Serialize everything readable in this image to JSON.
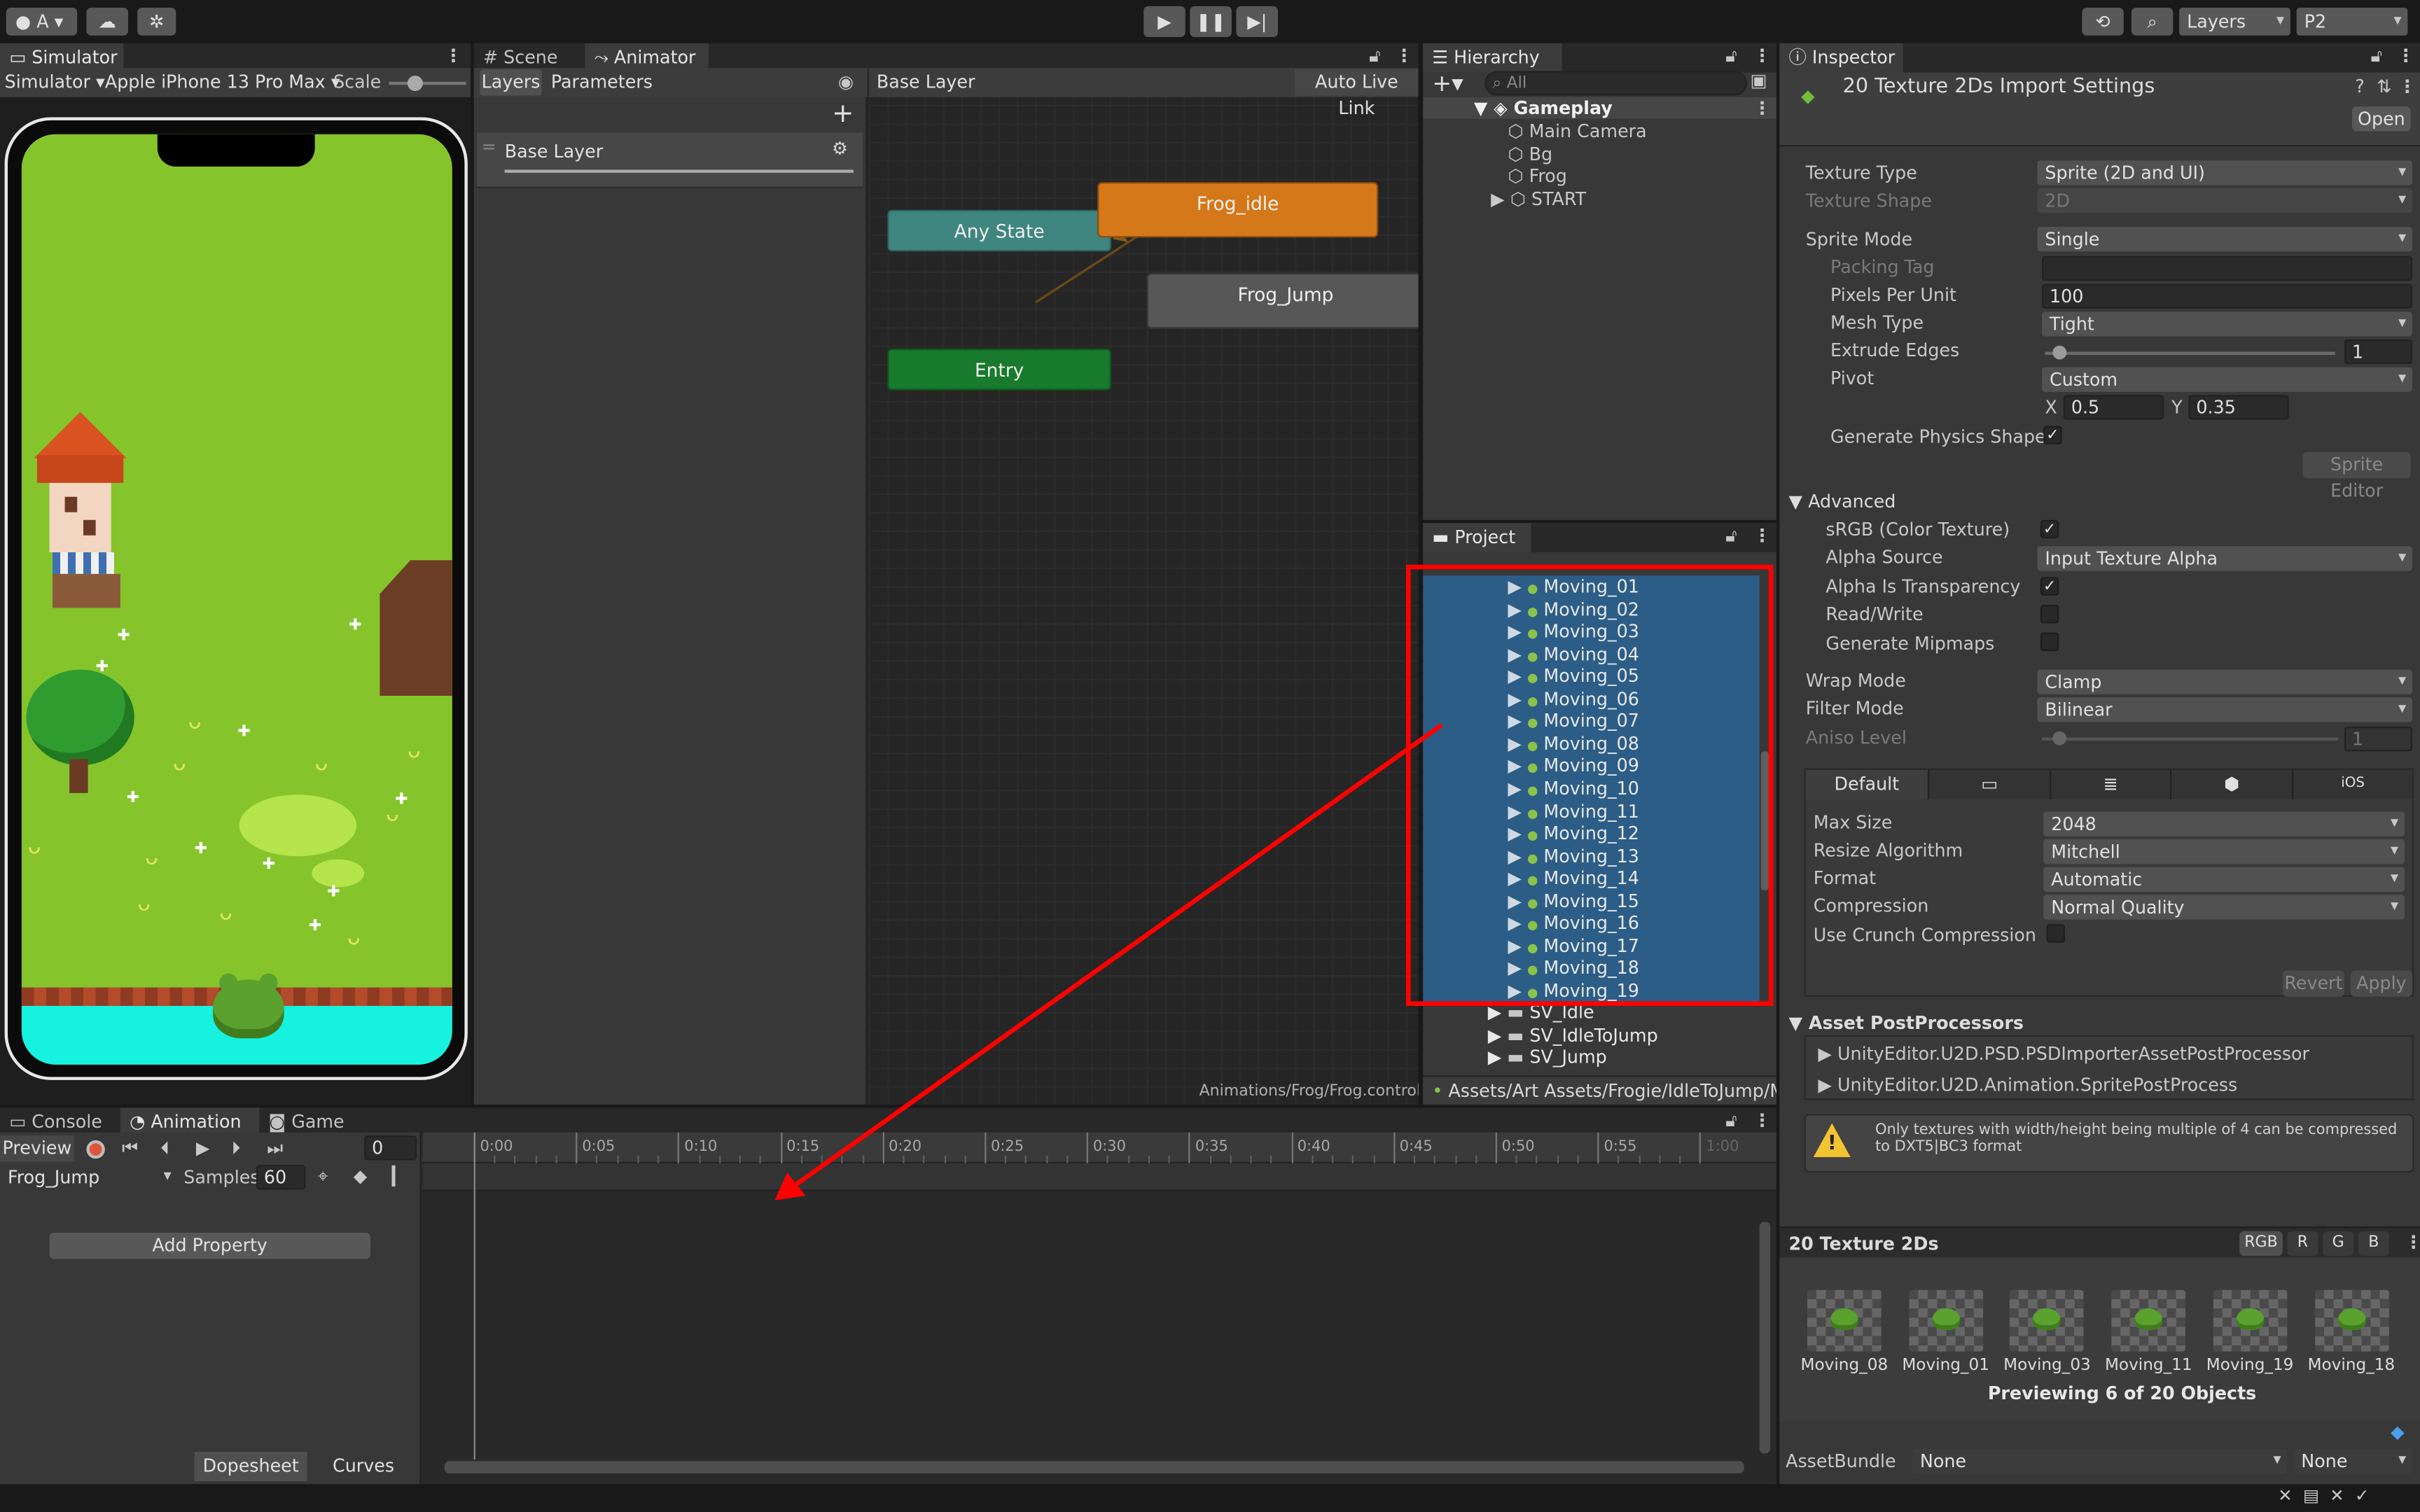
{
  "colors": {
    "accent": "#ff0000",
    "selection": "#2c5d87",
    "orange_state": "#d9791a",
    "teal_state": "#3a8a85",
    "green_state": "#18802f",
    "gray_state": "#5c5c5c"
  },
  "toolbar": {
    "account": "A",
    "layers": "Layers",
    "layout": "P2"
  },
  "simulator": {
    "tab": "Simulator",
    "mode": "Simulator",
    "device": "Apple iPhone 13 Pro Max",
    "scale_label": "Scale"
  },
  "scene_tab": "Scene",
  "animator": {
    "tab": "Animator",
    "tabs": [
      "Layers",
      "Parameters"
    ],
    "breadcrumb": "Base Layer",
    "live_link": "Auto Live Link",
    "layer_name": "Base Layer",
    "states": {
      "any": "Any State",
      "idle": "Frog_idle",
      "jump": "Frog_Jump",
      "entry": "Entry"
    },
    "footer_path": "Animations/Frog/Frog.controller"
  },
  "hierarchy": {
    "tab": "Hierarchy",
    "search_placeholder": "All",
    "scene": "Gameplay",
    "items": [
      "Main Camera",
      "Bg",
      "Frog",
      "START"
    ]
  },
  "project": {
    "tab": "Project",
    "files": [
      "Moving_01",
      "Moving_02",
      "Moving_03",
      "Moving_04",
      "Moving_05",
      "Moving_06",
      "Moving_07",
      "Moving_08",
      "Moving_09",
      "Moving_10",
      "Moving_11",
      "Moving_12",
      "Moving_13",
      "Moving_14",
      "Moving_15",
      "Moving_16",
      "Moving_17",
      "Moving_18",
      "Moving_19"
    ],
    "folders": [
      "SV_Idle",
      "SV_IdleToJump",
      "SV_Jump"
    ],
    "path": "Assets/Art Assets/Frogie/IdleToJump/Mo"
  },
  "inspector": {
    "tab": "Inspector",
    "title": "20 Texture 2Ds Import Settings",
    "open_btn": "Open",
    "props": {
      "texture_type": {
        "label": "Texture Type",
        "value": "Sprite (2D and UI)"
      },
      "texture_shape": {
        "label": "Texture Shape",
        "value": "2D"
      },
      "sprite_mode": {
        "label": "Sprite Mode",
        "value": "Single"
      },
      "packing_tag": {
        "label": "Packing Tag",
        "value": ""
      },
      "ppu": {
        "label": "Pixels Per Unit",
        "value": "100"
      },
      "mesh_type": {
        "label": "Mesh Type",
        "value": "Tight"
      },
      "extrude": {
        "label": "Extrude Edges",
        "value": "1",
        "fraction": 0.05
      },
      "pivot": {
        "label": "Pivot",
        "value": "Custom"
      },
      "pivot_x": {
        "label": "X",
        "value": "0.5"
      },
      "pivot_y": {
        "label": "Y",
        "value": "0.35"
      },
      "physics": {
        "label": "Generate Physics Shape"
      },
      "sprite_editor": "Sprite Editor",
      "advanced": "Advanced",
      "srgb": {
        "label": "sRGB (Color Texture)"
      },
      "alpha_source": {
        "label": "Alpha Source",
        "value": "Input Texture Alpha"
      },
      "alpha_transp": {
        "label": "Alpha Is Transparency"
      },
      "read_write": {
        "label": "Read/Write"
      },
      "mipmaps": {
        "label": "Generate Mipmaps"
      },
      "wrap": {
        "label": "Wrap Mode",
        "value": "Clamp"
      },
      "filter": {
        "label": "Filter Mode",
        "value": "Bilinear"
      },
      "aniso": {
        "label": "Aniso Level",
        "value": "1",
        "fraction": 0.05
      }
    },
    "platform": {
      "default_tab": "Default",
      "ios_tab": "iOS",
      "max_size": {
        "label": "Max Size",
        "value": "2048"
      },
      "resize": {
        "label": "Resize Algorithm",
        "value": "Mitchell"
      },
      "format": {
        "label": "Format",
        "value": "Automatic"
      },
      "compression": {
        "label": "Compression",
        "value": "Normal Quality"
      },
      "crunch": {
        "label": "Use Crunch Compression"
      }
    },
    "revert": "Revert",
    "apply": "Apply",
    "postprocessors": {
      "title": "Asset PostProcessors",
      "items": [
        "UnityEditor.U2D.PSD.PSDImporterAssetPostProcessor",
        "UnityEditor.U2D.Animation.SpritePostProcess"
      ]
    },
    "warning": "Only textures with width/height being multiple of 4 can be compressed to DXT5|BC3 format",
    "preview": {
      "title": "20 Texture 2Ds",
      "channels": [
        "RGB",
        "R",
        "G",
        "B"
      ],
      "thumbs": [
        "Moving_08",
        "Moving_01",
        "Moving_03",
        "Moving_11",
        "Moving_19",
        "Moving_18"
      ],
      "caption": "Previewing 6 of 20 Objects"
    },
    "assetbundle": {
      "label": "AssetBundle",
      "name": "None",
      "variant": "None"
    }
  },
  "bottom": {
    "tabs": [
      "Console",
      "Animation",
      "Game"
    ],
    "preview_label": "Preview",
    "frame": "0",
    "clip": "Frog_Jump",
    "samples_label": "Samples",
    "samples": "60",
    "add_property": "Add Property",
    "ticks": [
      "0:00",
      "0:05",
      "0:10",
      "0:15",
      "0:20",
      "0:25",
      "0:30",
      "0:35",
      "0:40",
      "0:45",
      "0:50",
      "0:55",
      "1:00"
    ],
    "dopesheet": "Dopesheet",
    "curves": "Curves"
  }
}
